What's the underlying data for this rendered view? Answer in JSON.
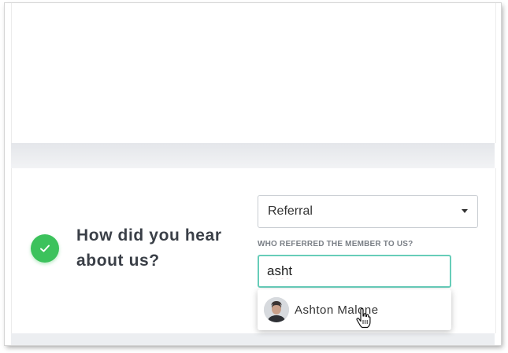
{
  "question": {
    "line1": "How did you hear",
    "line2": "about us?"
  },
  "source_select": {
    "selected": "Referral"
  },
  "referrer_field": {
    "label": "WHO REFERRED THE MEMBER TO US?",
    "value": "asht"
  },
  "suggestions": [
    {
      "name": "Ashton Malone"
    }
  ],
  "icons": {
    "status": "check-icon",
    "select_caret": "caret-down-icon",
    "pointer": "hand-pointer-icon"
  },
  "colors": {
    "check_green": "#3cc25c",
    "input_focus": "#67cdb9",
    "heading_text": "#3a3f47"
  }
}
